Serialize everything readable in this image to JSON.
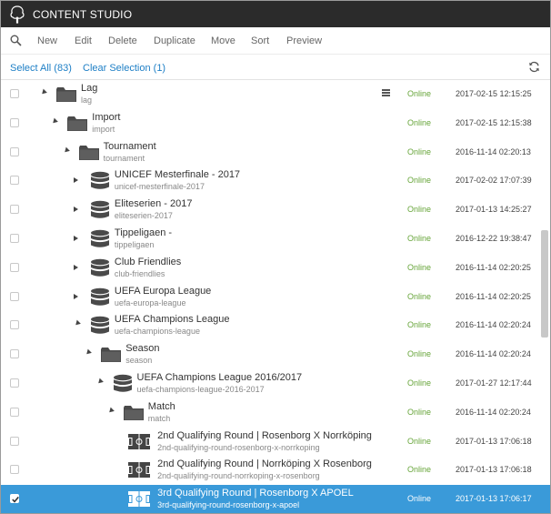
{
  "app": {
    "title": "CONTENT STUDIO"
  },
  "toolbar": {
    "new": "New",
    "edit": "Edit",
    "delete": "Delete",
    "duplicate": "Duplicate",
    "move": "Move",
    "sort": "Sort",
    "preview": "Preview"
  },
  "selection": {
    "select_all": "Select All (83)",
    "clear_selection": "Clear Selection (1)"
  },
  "colors": {
    "topbar": "#2b2b2b",
    "accent": "#1e7fc6",
    "online": "#67a53a",
    "selected_row": "#3a9ad9"
  },
  "rows": [
    {
      "title": "Lag",
      "path": "lag",
      "status": "Online",
      "date": "2017-02-15 12:15:25",
      "icon": "folder-icon",
      "expanded": true,
      "selected": false
    },
    {
      "title": "Import",
      "path": "import",
      "status": "Online",
      "date": "2017-02-15 12:15:38",
      "icon": "folder-icon",
      "expanded": true,
      "selected": false
    },
    {
      "title": "Tournament",
      "path": "tournament",
      "status": "Online",
      "date": "2016-11-14 02:20:13",
      "icon": "folder-icon",
      "expanded": true,
      "selected": false
    },
    {
      "title": "UNICEF Mesterfinale - 2017",
      "path": "unicef-mesterfinale-2017",
      "status": "Online",
      "date": "2017-02-02 17:07:39",
      "icon": "database-icon",
      "expanded": false,
      "selected": false
    },
    {
      "title": "Eliteserien - 2017",
      "path": "eliteserien-2017",
      "status": "Online",
      "date": "2017-01-13 14:25:27",
      "icon": "database-icon",
      "expanded": false,
      "selected": false
    },
    {
      "title": "Tippeligaen -",
      "path": "tippeligaen",
      "status": "Online",
      "date": "2016-12-22 19:38:47",
      "icon": "database-icon",
      "expanded": false,
      "selected": false
    },
    {
      "title": "Club Friendlies",
      "path": "club-friendlies",
      "status": "Online",
      "date": "2016-11-14 02:20:25",
      "icon": "database-icon",
      "expanded": false,
      "selected": false
    },
    {
      "title": "UEFA Europa League",
      "path": "uefa-europa-league",
      "status": "Online",
      "date": "2016-11-14 02:20:25",
      "icon": "database-icon",
      "expanded": false,
      "selected": false
    },
    {
      "title": "UEFA Champions League",
      "path": "uefa-champions-league",
      "status": "Online",
      "date": "2016-11-14 02:20:24",
      "icon": "database-icon",
      "expanded": true,
      "selected": false
    },
    {
      "title": "Season",
      "path": "season",
      "status": "Online",
      "date": "2016-11-14 02:20:24",
      "icon": "folder-icon",
      "expanded": true,
      "selected": false
    },
    {
      "title": "UEFA Champions League 2016/2017",
      "path": "uefa-champions-league-2016-2017",
      "status": "Online",
      "date": "2017-01-27 12:17:44",
      "icon": "database-icon",
      "expanded": true,
      "selected": false
    },
    {
      "title": "Match",
      "path": "match",
      "status": "Online",
      "date": "2016-11-14 02:20:24",
      "icon": "folder-icon",
      "expanded": true,
      "selected": false
    },
    {
      "title": "2nd Qualifying Round | Rosenborg X Norrköping",
      "path": "2nd-qualifying-round-rosenborg-x-norrkoping",
      "status": "Online",
      "date": "2017-01-13 17:06:18",
      "icon": "football-pitch-icon",
      "expanded": null,
      "selected": false
    },
    {
      "title": "2nd Qualifying Round | Norrköping X Rosenborg",
      "path": "2nd-qualifying-round-norrkoping-x-rosenborg",
      "status": "Online",
      "date": "2017-01-13 17:06:18",
      "icon": "football-pitch-icon",
      "expanded": null,
      "selected": false
    },
    {
      "title": "3rd Qualifying Round | Rosenborg X APOEL",
      "path": "3rd-qualifying-round-rosenborg-x-apoel",
      "status": "Online",
      "date": "2017-01-13 17:06:17",
      "icon": "football-pitch-icon",
      "expanded": null,
      "selected": true
    }
  ]
}
